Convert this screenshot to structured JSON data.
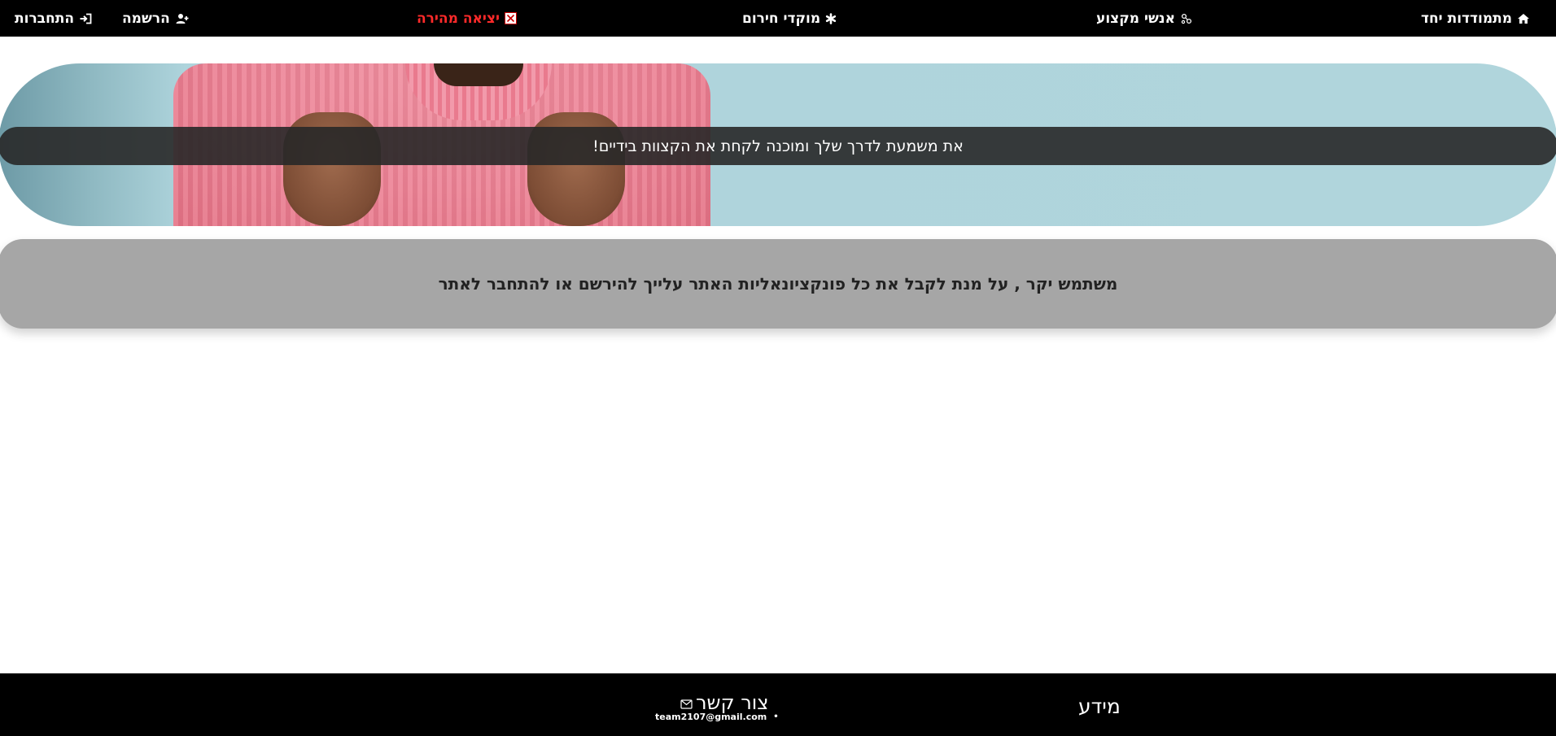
{
  "nav": {
    "home": "מתמודדות יחד",
    "professionals": "אנשי מקצוע",
    "emergency": "מוקדי חירום",
    "quick_exit": "יציאה מהירה",
    "register": "הרשמה",
    "login": "התחברות"
  },
  "hero": {
    "caption": "את משמעת לדרך שלך ומוכנה לקחת את הקצוות בידיים!"
  },
  "notice": {
    "text": "משתמש יקר , על מנת לקבל את כל פונקציונאליות האתר עלייך להירשם או להתחבר לאתר"
  },
  "footer": {
    "info_title": "מידע",
    "contact_title": "צור קשר",
    "email": "team2107@gmail.com"
  },
  "colors": {
    "nav_bg": "#000000",
    "quick_exit": "#ff2a2a",
    "notice_bg": "#a6a6a6",
    "hero_bg": "#b0d5dc"
  }
}
